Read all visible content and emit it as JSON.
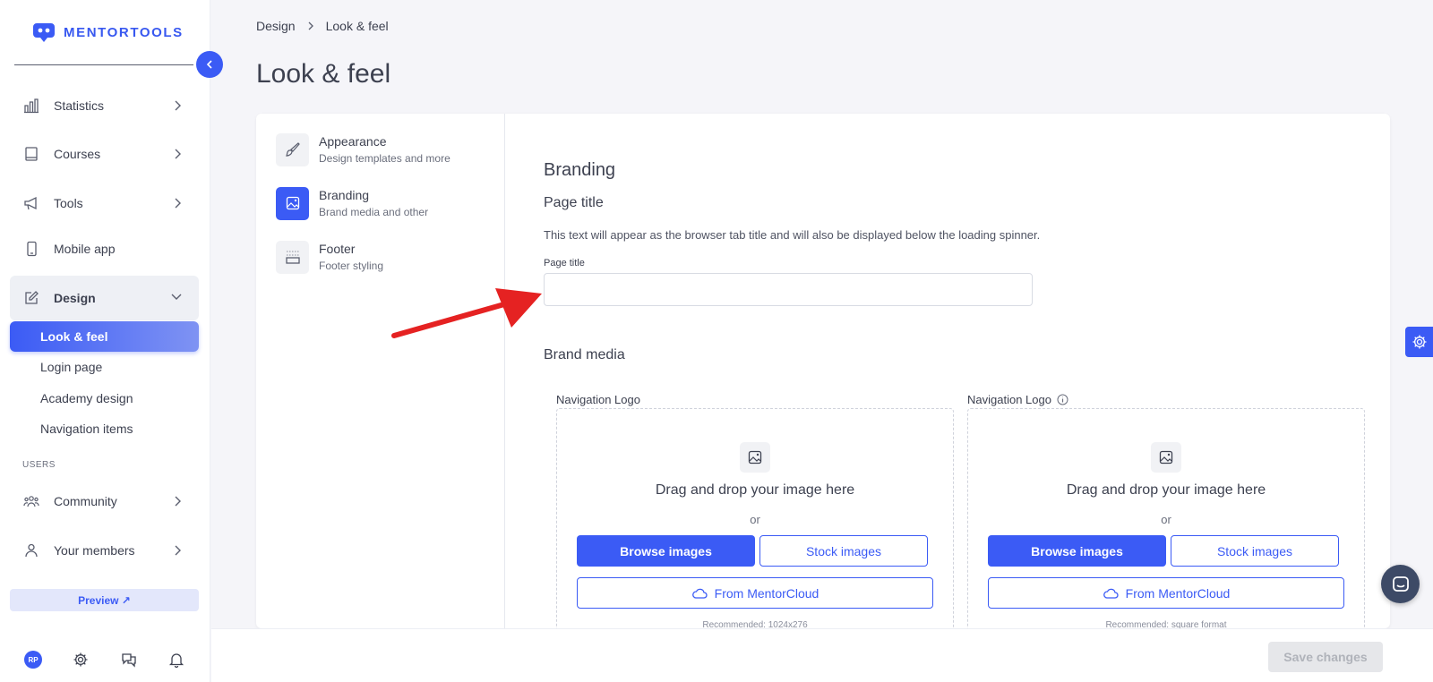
{
  "brand": {
    "name": "MENTORTOOLS",
    "accent": "#3b5bf5"
  },
  "sidebar": {
    "items": [
      {
        "label": "Statistics",
        "icon": "bar-chart-icon"
      },
      {
        "label": "Courses",
        "icon": "book-icon"
      },
      {
        "label": "Tools",
        "icon": "megaphone-icon"
      },
      {
        "label": "Mobile app",
        "icon": "mobile-icon"
      },
      {
        "label": "Design",
        "icon": "edit-icon"
      }
    ],
    "design_sub": [
      {
        "label": "Look & feel"
      },
      {
        "label": "Login page"
      },
      {
        "label": "Academy design"
      },
      {
        "label": "Navigation items"
      }
    ],
    "users_section": "USERS",
    "user_items": [
      {
        "label": "Community",
        "icon": "community-icon"
      },
      {
        "label": "Your members",
        "icon": "user-icon"
      }
    ],
    "preview_label": "Preview ↗",
    "avatar_initials": "RP"
  },
  "breadcrumb": {
    "parent": "Design",
    "current": "Look & feel"
  },
  "page_title": "Look & feel",
  "sections": [
    {
      "title": "Appearance",
      "subtitle": "Design templates and more"
    },
    {
      "title": "Branding",
      "subtitle": "Brand media and other"
    },
    {
      "title": "Footer",
      "subtitle": "Footer styling"
    }
  ],
  "branding": {
    "heading": "Branding",
    "page_title_heading": "Page title",
    "page_title_desc": "This text will appear as the browser tab title and will also be displayed below the loading spinner.",
    "page_title_label": "Page title",
    "page_title_value": "",
    "brand_media_heading": "Brand media"
  },
  "uploads": [
    {
      "label": "Navigation Logo",
      "drag_text": "Drag and drop your image here",
      "or_text": "or",
      "browse_label": "Browse images",
      "stock_label": "Stock images",
      "cloud_label": "From MentorCloud",
      "recommendation": "Recommended: 1024x276"
    },
    {
      "label": "Navigation Logo",
      "drag_text": "Drag and drop your image here",
      "or_text": "or",
      "browse_label": "Browse images",
      "stock_label": "Stock images",
      "cloud_label": "From MentorCloud",
      "recommendation": "Recommended: square format"
    }
  ],
  "footer": {
    "save_label": "Save changes"
  }
}
